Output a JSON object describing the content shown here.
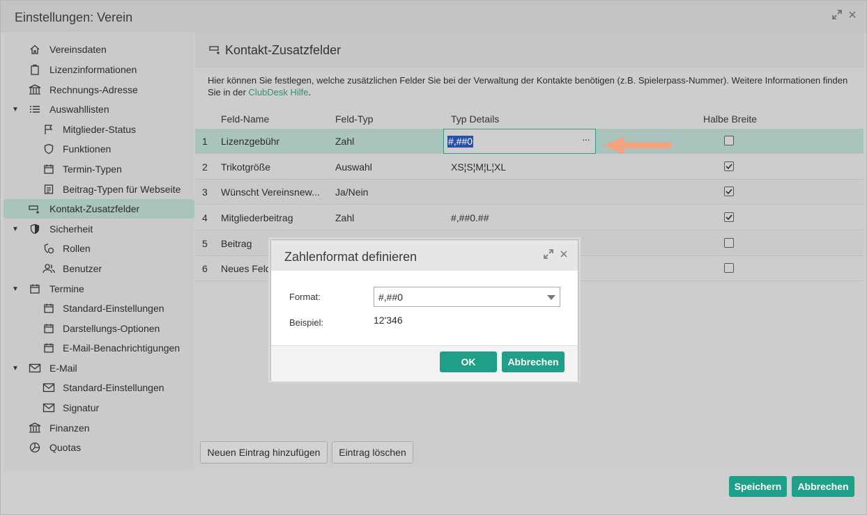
{
  "window": {
    "title": "Einstellungen: Verein"
  },
  "sidebar": {
    "items": [
      {
        "label": "Vereinsdaten",
        "icon": "home-icon"
      },
      {
        "label": "Lizenzinformationen",
        "icon": "clipboard-icon"
      },
      {
        "label": "Rechnungs-Adresse",
        "icon": "bank-icon"
      },
      {
        "label": "Auswahllisten",
        "icon": "list-icon"
      },
      {
        "label": "Mitglieder-Status",
        "icon": "flag-icon"
      },
      {
        "label": "Funktionen",
        "icon": "shield-icon"
      },
      {
        "label": "Termin-Typen",
        "icon": "calendar-icon"
      },
      {
        "label": "Beitrag-Typen für Webseite",
        "icon": "document-icon"
      },
      {
        "label": "Kontakt-Zusatzfelder",
        "icon": "add-field-icon"
      },
      {
        "label": "Sicherheit",
        "icon": "security-shield-icon"
      },
      {
        "label": "Rollen",
        "icon": "role-icon"
      },
      {
        "label": "Benutzer",
        "icon": "users-icon"
      },
      {
        "label": "Termine",
        "icon": "calendar-icon"
      },
      {
        "label": "Standard-Einstellungen",
        "icon": "calendar-icon"
      },
      {
        "label": "Darstellungs-Optionen",
        "icon": "calendar-icon"
      },
      {
        "label": "E-Mail-Benachrichtigungen",
        "icon": "calendar-icon"
      },
      {
        "label": "E-Mail",
        "icon": "mail-icon"
      },
      {
        "label": "Standard-Einstellungen",
        "icon": "mail-icon"
      },
      {
        "label": "Signatur",
        "icon": "mail-icon"
      },
      {
        "label": "Finanzen",
        "icon": "bank-icon"
      },
      {
        "label": "Quotas",
        "icon": "pie-icon"
      }
    ]
  },
  "panel": {
    "title": "Kontakt-Zusatzfelder",
    "description": "Hier können Sie festlegen, welche zusätzlichen Felder Sie bei der Verwaltung der Kontakte benötigen (z.B. Spielerpass-Nummer). Weitere Informationen finden Sie in der ",
    "help_link": "ClubDesk Hilfe",
    "description_end": "."
  },
  "table": {
    "headers": [
      "Feld-Name",
      "Feld-Typ",
      "Typ Details",
      "Halbe Breite"
    ],
    "rows": [
      {
        "num": "1",
        "name": "Lizenzgebühr",
        "type": "Zahl",
        "details": "#,##0",
        "half": false
      },
      {
        "num": "2",
        "name": "Trikotgröße",
        "type": "Auswahl",
        "details": "XS¦S¦M¦L¦XL",
        "half": true
      },
      {
        "num": "3",
        "name": "Wünscht Vereinsnew...",
        "type": "Ja/Nein",
        "details": "",
        "half": true
      },
      {
        "num": "4",
        "name": "Mitgliederbeitrag",
        "type": "Zahl",
        "details": "#,##0.##",
        "half": true
      },
      {
        "num": "5",
        "name": "Beitrag",
        "type": "",
        "details": "",
        "half": false
      },
      {
        "num": "6",
        "name": "Neues Feld",
        "type": "",
        "details": "",
        "half": false
      }
    ]
  },
  "buttons": {
    "add_entry": "Neuen Eintrag hinzufügen",
    "delete_entry": "Eintrag löschen",
    "save": "Speichern",
    "cancel": "Abbrechen"
  },
  "dialog": {
    "title": "Zahlenformat definieren",
    "format_label": "Format:",
    "format_value": "#,##0",
    "example_label": "Beispiel:",
    "example_value": "12'346",
    "ok": "OK",
    "cancel": "Abbrechen"
  },
  "colors": {
    "accent": "#1f9f87",
    "selection": "#a9c4bd",
    "arrow": "#f4a27f"
  }
}
